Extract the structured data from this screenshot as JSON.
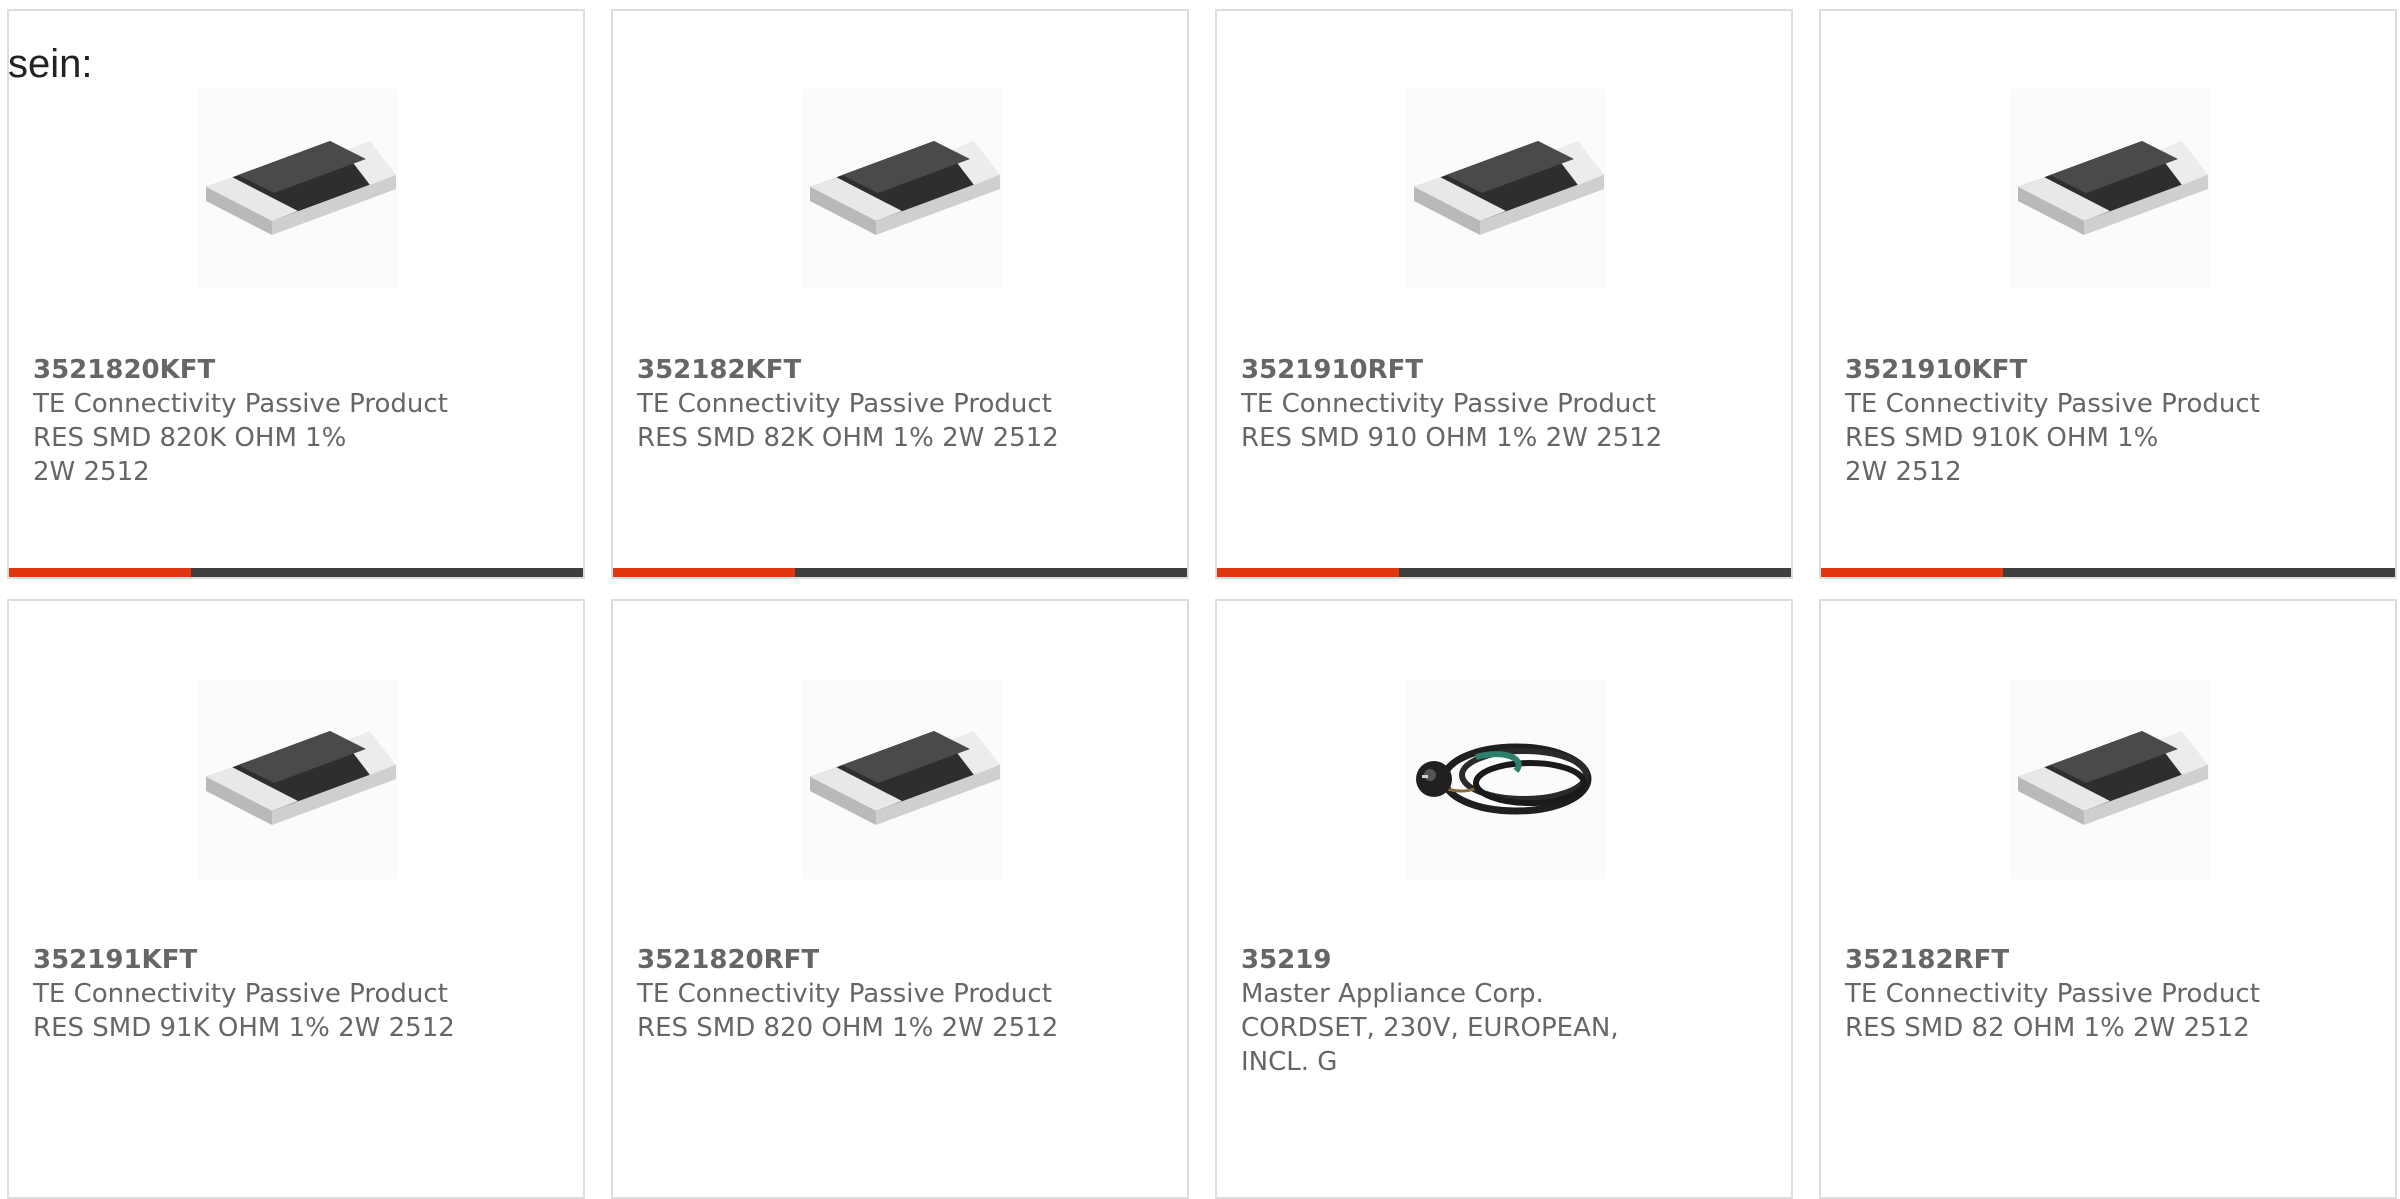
{
  "intro_text": "sein:",
  "colors": {
    "accent": "#e2360f",
    "bar_dark": "#3f3f3f",
    "text": "#666666",
    "border": "#dddddd"
  },
  "products": [
    {
      "part_number": "3521820KFT",
      "manufacturer": "TE Connectivity Passive Product",
      "description": "RES SMD 820K OHM 1% 2W 2512",
      "image_icon": "smd-resistor-icon"
    },
    {
      "part_number": "352182KFT",
      "manufacturer": "TE Connectivity Passive Product",
      "description": "RES SMD 82K OHM 1% 2W 2512",
      "image_icon": "smd-resistor-icon"
    },
    {
      "part_number": "3521910RFT",
      "manufacturer": "TE Connectivity Passive Product",
      "description": "RES SMD 910 OHM 1% 2W 2512",
      "image_icon": "smd-resistor-icon"
    },
    {
      "part_number": "3521910KFT",
      "manufacturer": "TE Connectivity Passive Product",
      "description": "RES SMD 910K OHM 1% 2W 2512",
      "image_icon": "smd-resistor-icon"
    },
    {
      "part_number": "352191KFT",
      "manufacturer": "TE Connectivity Passive Product",
      "description": "RES SMD 91K OHM 1% 2W 2512",
      "image_icon": "smd-resistor-icon"
    },
    {
      "part_number": "3521820RFT",
      "manufacturer": "TE Connectivity Passive Product",
      "description": "RES SMD 820 OHM 1% 2W 2512",
      "image_icon": "smd-resistor-icon"
    },
    {
      "part_number": "35219",
      "manufacturer": "Master Appliance Corp.",
      "description": "CORDSET, 230V, EUROPEAN, INCL. G",
      "image_icon": "power-cord-icon"
    },
    {
      "part_number": "352182RFT",
      "manufacturer": "TE Connectivity Passive Product",
      "description": "RES SMD 82 OHM 1% 2W 2512",
      "image_icon": "smd-resistor-icon"
    }
  ]
}
